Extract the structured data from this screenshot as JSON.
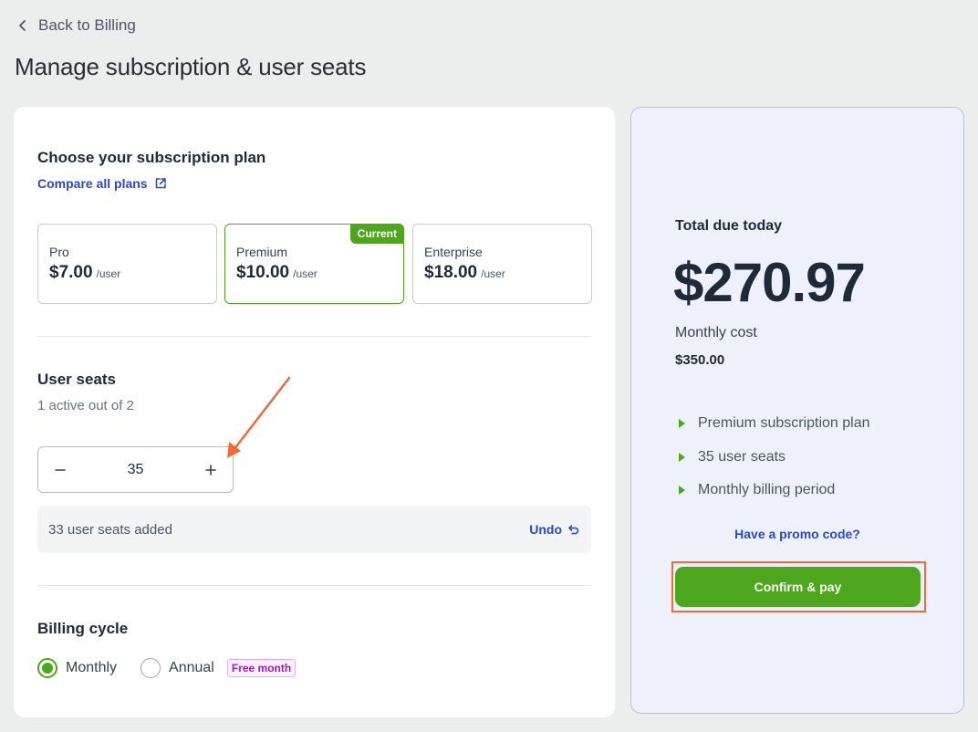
{
  "nav": {
    "back_label": "Back to Billing"
  },
  "page": {
    "title": "Manage subscription & user seats"
  },
  "plans_section": {
    "heading": "Choose your subscription plan",
    "compare_link": "Compare all plans",
    "plans": [
      {
        "name": "Pro",
        "price": "$7.00",
        "unit": "/user"
      },
      {
        "name": "Premium",
        "price": "$10.00",
        "unit": "/user",
        "badge": "Current"
      },
      {
        "name": "Enterprise",
        "price": "$18.00",
        "unit": "/user"
      }
    ]
  },
  "seats_section": {
    "heading": "User seats",
    "subtitle": "1 active out of 2",
    "stepper_value": "35",
    "added_text": "33 user seats added",
    "undo_label": "Undo"
  },
  "billing_section": {
    "heading": "Billing cycle",
    "options": [
      {
        "label": "Monthly",
        "selected": true
      },
      {
        "label": "Annual",
        "selected": false,
        "badge": "Free month"
      }
    ]
  },
  "summary": {
    "total_label": "Total due today",
    "total_amount": "$270.97",
    "monthly_label": "Monthly cost",
    "monthly_value": "$350.00",
    "items": [
      "Premium subscription plan",
      "35 user seats",
      "Monthly billing period"
    ],
    "promo_label": "Have a promo code?",
    "pay_label": "Confirm & pay"
  },
  "colors": {
    "accent_green": "#4ea51e",
    "link_blue": "#2a48c9",
    "annotation_orange": "#f06a3b",
    "badge_magenta": "#a21caf"
  }
}
